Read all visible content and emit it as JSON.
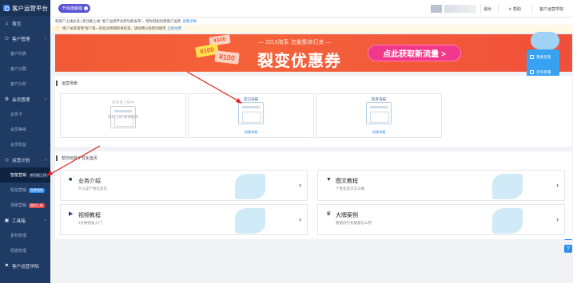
{
  "sidebar": {
    "title": "客户运营平台",
    "items": [
      {
        "label": "首页",
        "icon": "home-icon"
      },
      {
        "label": "客户管理",
        "icon": "users-icon"
      },
      {
        "label": "客户列表"
      },
      {
        "label": "客户分群"
      },
      {
        "label": "客户分析"
      },
      {
        "label": "会员管理",
        "icon": "gear-icon"
      },
      {
        "label": "会员卡"
      },
      {
        "label": "会员等级"
      },
      {
        "label": "会员权益"
      },
      {
        "label": "运营计划",
        "icon": "diamond-icon"
      },
      {
        "label": "智能营销",
        "tag": "新功能上线"
      },
      {
        "label": "短信营销",
        "tag": "免费领取"
      },
      {
        "label": "场景营销",
        "tag": "限时上新"
      },
      {
        "label": "工具箱",
        "icon": "toolbox-icon"
      },
      {
        "label": "素材管理"
      },
      {
        "label": "短链管理"
      },
      {
        "label": "客户运营学院",
        "icon": "school-icon"
      }
    ]
  },
  "topbar": {
    "upgrade_label": "升级旗舰版",
    "logout_label": "退出",
    "help_label": "帮助",
    "academy_label": "客户运营学院"
  },
  "notices": {
    "line1": "新客户上线必读 | 新功能上线 \"客户运营平台新功能发布\"，帮你轻松玩转客户运营",
    "line1_link": "查看详情",
    "line2": "\"客户关系管理\"客户第一阶段试用期即将结束，请续费以免影响使用",
    "line2_link": "立即续费"
  },
  "banner": {
    "sub": "— 2019淘系 流量集体归来 —",
    "title": "裂变优惠券",
    "cta": "点此获取新流量 >",
    "coupon1": "¥100",
    "coupon2": "¥100",
    "coupon3": "¥100"
  },
  "float_panel": {
    "item1": "我要反馈",
    "item2": "咨询客服"
  },
  "section1": {
    "title": "运营场景",
    "cards": [
      {
        "top": "新场景上线中",
        "mid": "即将上线 敬请期待",
        "bottom": ""
      },
      {
        "top": "定向海报",
        "bottom": "创建海报"
      },
      {
        "top": "裂变海报",
        "bottom": "创建海报"
      }
    ]
  },
  "section2": {
    "title": "帮你玩转个性化首页",
    "features": [
      {
        "title": "业务介绍",
        "sub": "什么是个性化首页",
        "icon": "briefcase-icon"
      },
      {
        "title": "图文教程",
        "sub": "个性化首页怎么做",
        "icon": "triangle-down-icon"
      },
      {
        "title": "视频教程",
        "sub": "2分钟快速入门",
        "icon": "play-icon"
      },
      {
        "title": "大牌案例",
        "sub": "看看同行有家都怎么用",
        "icon": "crown-icon"
      }
    ]
  },
  "colors": {
    "sidebar_bg": "#1f3b64",
    "accent": "#2d8cf0",
    "banner": "#f25a36",
    "cta_pink": "#f2388a",
    "upgrade_purple": "#5a54d6"
  }
}
